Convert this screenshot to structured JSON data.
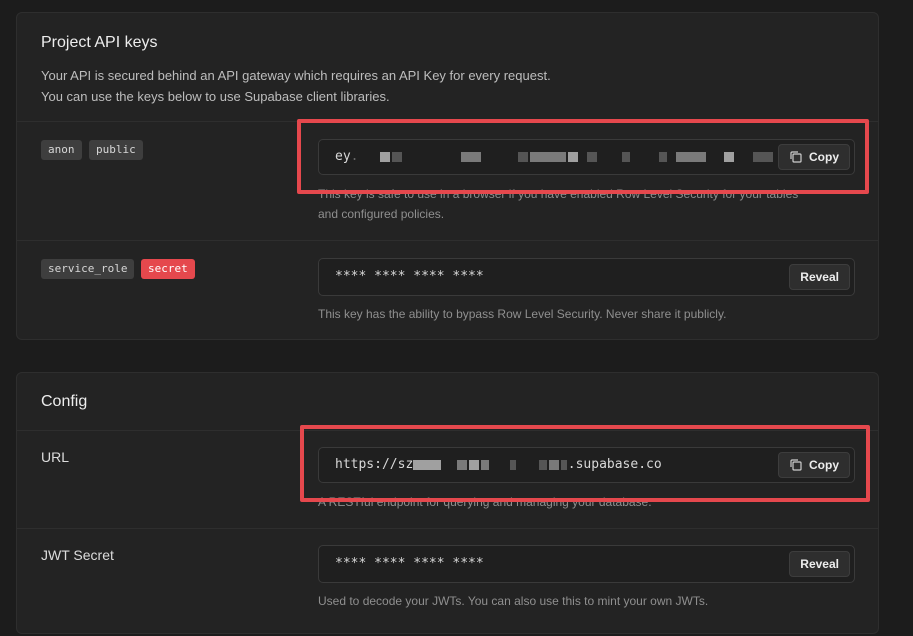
{
  "api_keys": {
    "title": "Project API keys",
    "description_line1": "Your API is secured behind an API gateway which requires an API Key for every request.",
    "description_line2": "You can use the keys below to use Supabase client libraries.",
    "anon": {
      "badges": [
        "anon",
        "public"
      ],
      "value_prefix": "ey",
      "button_label": "Copy",
      "helper_line1": "This key is safe to use in a browser if you have enabled Row Level Security for your tables",
      "helper_line2": "and configured policies."
    },
    "service_role": {
      "badges": [
        "service_role",
        "secret"
      ],
      "value": "**** **** **** ****",
      "button_label": "Reveal",
      "helper": "This key has the ability to bypass Row Level Security. Never share it publicly."
    }
  },
  "config": {
    "title": "Config",
    "url": {
      "label": "URL",
      "value_prefix": "https://sz",
      "value_suffix": ".supabase.co",
      "button_label": "Copy",
      "helper": "A RESTful endpoint for querying and managing your database."
    },
    "jwt": {
      "label": "JWT Secret",
      "value": "**** **** **** ****",
      "button_label": "Reveal",
      "helper": "Used to decode your JWTs. You can also use this to mint your own JWTs."
    }
  },
  "colors": {
    "highlight": "#e5484d",
    "background": "#1c1c1c",
    "panel": "#232323"
  }
}
